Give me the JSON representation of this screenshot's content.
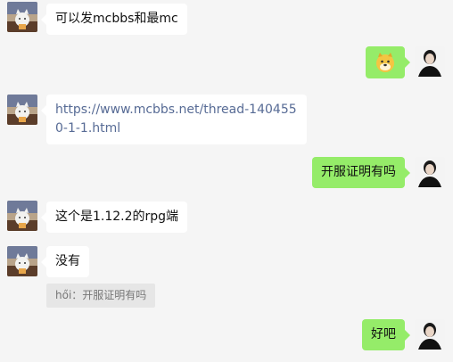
{
  "messages": [
    {
      "id": "m1",
      "side": "in",
      "text": "可以发mcbbs和最mc"
    },
    {
      "id": "m2",
      "side": "out",
      "sticker": "doge-face-icon"
    },
    {
      "id": "m3",
      "side": "in",
      "text": "https://www.mcbbs.net/thread-1404550-1-1.html",
      "is_link": true
    },
    {
      "id": "m4",
      "side": "out",
      "text": "开服证明有吗"
    },
    {
      "id": "m5",
      "side": "in",
      "text": "这个是1.12.2的rpg端"
    },
    {
      "id": "m6",
      "side": "in",
      "text": "没有"
    },
    {
      "id": "m7",
      "side": "out",
      "text": "好吧"
    }
  ],
  "quote": {
    "text": "hői：开服证明有吗"
  },
  "colors": {
    "background": "#f5f5f5",
    "incoming_bubble": "#ffffff",
    "outgoing_bubble": "#95ec69",
    "link": "#576b95",
    "quote_bg": "#e6e6e6"
  },
  "icons": {
    "incoming_avatar": "cat-avatar-icon",
    "outgoing_avatar": "person-avatar-icon"
  }
}
